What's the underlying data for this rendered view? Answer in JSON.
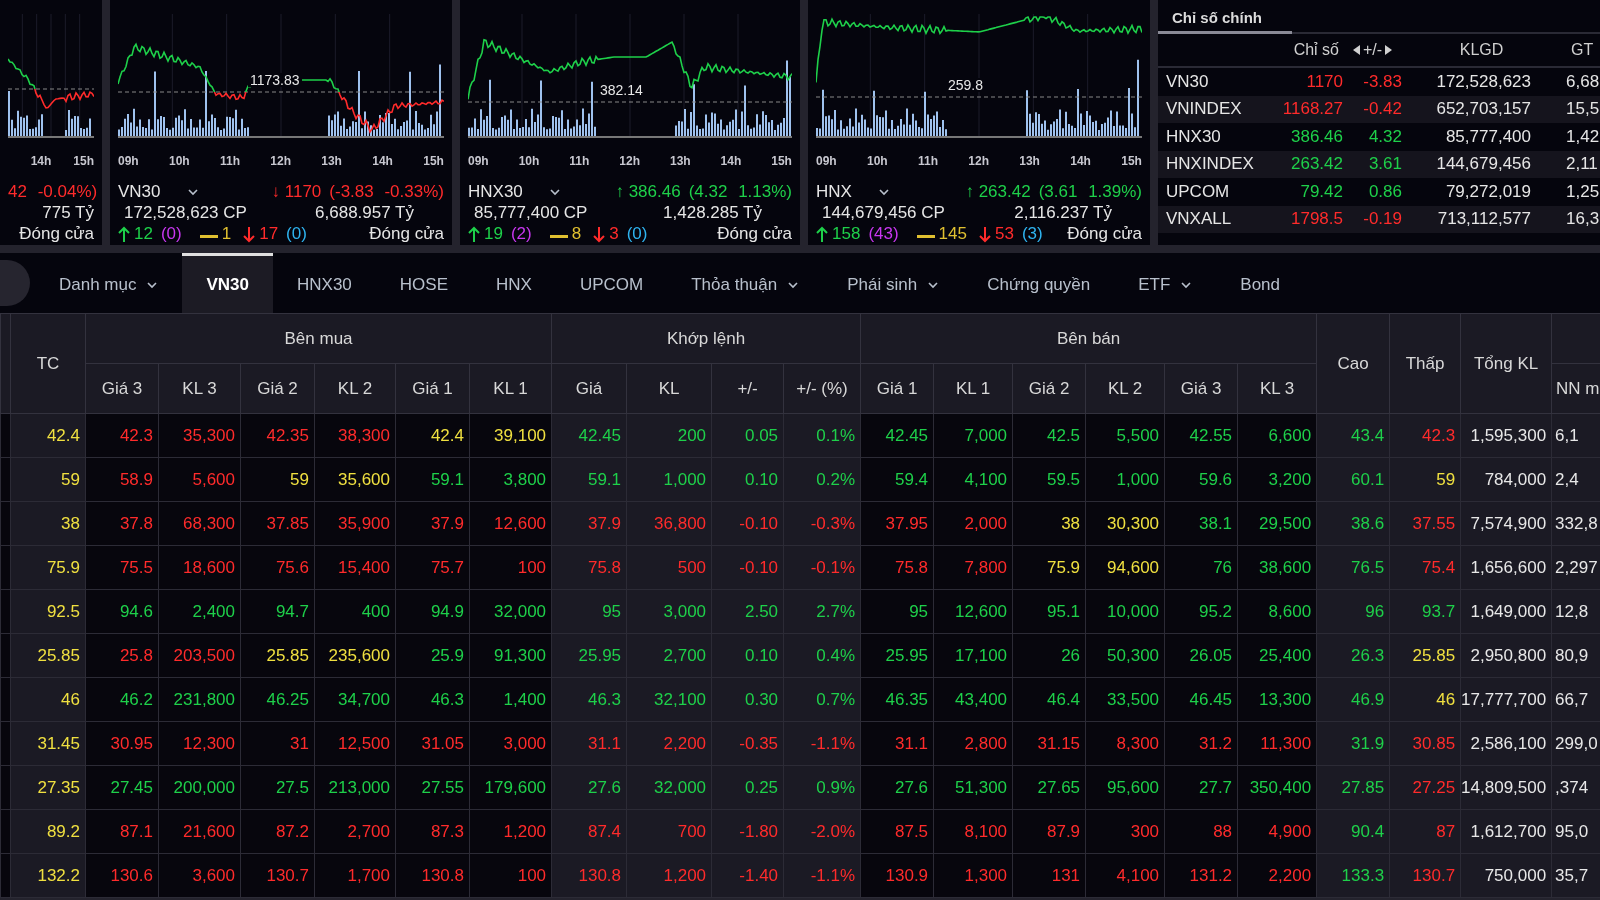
{
  "top_panels": [
    {
      "times": [
        "14h",
        "15h"
      ],
      "color": "#ff2b2b",
      "change_detail": "42 -0.04%)",
      "trade_value": "775 Tỷ",
      "status": "Đóng cửa"
    },
    {
      "name": "VN30",
      "times": [
        "09h",
        "10h",
        "11h",
        "12h",
        "13h",
        "14h",
        "15h"
      ],
      "reference_label": "1173.83",
      "arrow": "↓",
      "color": "#ff2b2b",
      "price": "1170",
      "change_detail": "(-3.83 -0.33%)",
      "volume": "172,528,623 CP",
      "trade_value": "6,688.957 Tỷ",
      "breadth": {
        "up": "12",
        "ceiling": "(0)",
        "flat": "1",
        "down": "17",
        "floor": "(0)"
      },
      "status": "Đóng cửa"
    },
    {
      "name": "HNX30",
      "times": [
        "09h",
        "10h",
        "11h",
        "12h",
        "13h",
        "14h",
        "15h"
      ],
      "reference_label": "382.14",
      "arrow": "↑",
      "color": "#1ed04a",
      "price": "386.46",
      "change_detail": "(4.32 1.13%)",
      "volume": "85,777,400 CP",
      "trade_value": "1,428.285 Tỷ",
      "breadth": {
        "up": "19",
        "ceiling": "(2)",
        "flat": "8",
        "down": "3",
        "floor": "(0)"
      },
      "status": "Đóng cửa"
    },
    {
      "name": "HNX",
      "times": [
        "09h",
        "10h",
        "11h",
        "12h",
        "13h",
        "14h",
        "15h"
      ],
      "reference_label": "259.8",
      "arrow": "↑",
      "color": "#1ed04a",
      "price": "263.42",
      "change_detail": "(3.61 1.39%)",
      "volume": "144,679,456 CP",
      "trade_value": "2,116.237 Tỷ",
      "breadth": {
        "up": "158",
        "ceiling": "(43)",
        "flat": "145",
        "down": "53",
        "floor": "(3)"
      },
      "status": "Đóng cửa"
    }
  ],
  "index_board": {
    "tab": "Chỉ số chính",
    "columns": [
      "Chỉ số",
      "+/-",
      "KLGD",
      "GT"
    ],
    "rows": [
      {
        "name": "VN30",
        "value": "1170",
        "change": "-3.83",
        "volume": "172,528,623",
        "trade_value": "6,68",
        "color": "#ff2b2b"
      },
      {
        "name": "VNINDEX",
        "value": "1168.27",
        "change": "-0.42",
        "volume": "652,703,157",
        "trade_value": "15,5",
        "color": "#ff2b2b"
      },
      {
        "name": "HNX30",
        "value": "386.46",
        "change": "4.32",
        "volume": "85,777,400",
        "trade_value": "1,42",
        "color": "#1ed04a"
      },
      {
        "name": "HNXINDEX",
        "value": "263.42",
        "change": "3.61",
        "volume": "144,679,456",
        "trade_value": "2,11",
        "color": "#1ed04a"
      },
      {
        "name": "UPCOM",
        "value": "79.42",
        "change": "0.86",
        "volume": "79,272,019",
        "trade_value": "1,25",
        "color": "#1ed04a"
      },
      {
        "name": "VNXALL",
        "value": "1798.5",
        "change": "-0.19",
        "volume": "713,112,577",
        "trade_value": "16,3",
        "color": "#ff2b2b"
      }
    ]
  },
  "tabs": [
    {
      "label": "Danh mục",
      "selected": false,
      "has_menu": true
    },
    {
      "label": "VN30",
      "selected": true,
      "has_menu": false
    },
    {
      "label": "HNX30",
      "selected": false,
      "has_menu": false
    },
    {
      "label": "HOSE",
      "selected": false,
      "has_menu": false
    },
    {
      "label": "HNX",
      "selected": false,
      "has_menu": false
    },
    {
      "label": "UPCOM",
      "selected": false,
      "has_menu": false
    },
    {
      "label": "Thỏa thuận",
      "selected": false,
      "has_menu": true
    },
    {
      "label": "Phái sinh",
      "selected": false,
      "has_menu": true
    },
    {
      "label": "Chứng quyền",
      "selected": false,
      "has_menu": false
    },
    {
      "label": "ETF",
      "selected": false,
      "has_menu": true
    },
    {
      "label": "Bond",
      "selected": false,
      "has_menu": false
    }
  ],
  "price_board": {
    "header": [
      {
        "label": "TC"
      },
      {
        "label": "Bên mua",
        "columns": [
          "Giá 3",
          "KL 3",
          "Giá 2",
          "KL 2",
          "Giá 1",
          "KL 1"
        ]
      },
      {
        "label": "Khớp lệnh",
        "columns": [
          "Giá",
          "KL",
          "+/-",
          "+/- (%)"
        ]
      },
      {
        "label": "Bên bán",
        "columns": [
          "Giá 1",
          "KL 1",
          "Giá 2",
          "KL 2",
          "Giá 3",
          "KL 3"
        ]
      },
      {
        "label": "Cao"
      },
      {
        "label": "Thấp"
      },
      {
        "label": "Tổng KL"
      },
      {
        "columns": [
          "NN m"
        ]
      }
    ],
    "rows": [
      {
        "cells": [
          {
            "text": "42.4",
            "color": "#f0e040"
          },
          {
            "text": "42.3",
            "color": "#ff2b2b"
          },
          {
            "text": "35,300",
            "color": "#ff2b2b"
          },
          {
            "text": "42.35",
            "color": "#ff2b2b"
          },
          {
            "text": "38,300",
            "color": "#ff2b2b"
          },
          {
            "text": "42.4",
            "color": "#f0e040"
          },
          {
            "text": "39,100",
            "color": "#f0e040"
          },
          {
            "text": "42.45",
            "color": "#1ed04a"
          },
          {
            "text": "200",
            "color": "#1ed04a"
          },
          {
            "text": "0.05",
            "color": "#1ed04a"
          },
          {
            "text": "0.1%",
            "color": "#1ed04a"
          },
          {
            "text": "42.45",
            "color": "#1ed04a"
          },
          {
            "text": "7,000",
            "color": "#1ed04a"
          },
          {
            "text": "42.5",
            "color": "#1ed04a"
          },
          {
            "text": "5,500",
            "color": "#1ed04a"
          },
          {
            "text": "42.55",
            "color": "#1ed04a"
          },
          {
            "text": "6,600",
            "color": "#1ed04a"
          },
          {
            "text": "43.4",
            "color": "#1ed04a"
          },
          {
            "text": "42.3",
            "color": "#ff2b2b"
          },
          {
            "text": "1,595,300",
            "color": "#e8e8e8"
          },
          {
            "text": "6,1",
            "color": "#e8e8e8"
          }
        ]
      },
      {
        "cells": [
          {
            "text": "59",
            "color": "#f0e040"
          },
          {
            "text": "58.9",
            "color": "#ff2b2b"
          },
          {
            "text": "5,600",
            "color": "#ff2b2b"
          },
          {
            "text": "59",
            "color": "#f0e040"
          },
          {
            "text": "35,600",
            "color": "#f0e040"
          },
          {
            "text": "59.1",
            "color": "#1ed04a"
          },
          {
            "text": "3,800",
            "color": "#1ed04a"
          },
          {
            "text": "59.1",
            "color": "#1ed04a"
          },
          {
            "text": "1,000",
            "color": "#1ed04a"
          },
          {
            "text": "0.10",
            "color": "#1ed04a"
          },
          {
            "text": "0.2%",
            "color": "#1ed04a"
          },
          {
            "text": "59.4",
            "color": "#1ed04a"
          },
          {
            "text": "4,100",
            "color": "#1ed04a"
          },
          {
            "text": "59.5",
            "color": "#1ed04a"
          },
          {
            "text": "1,000",
            "color": "#1ed04a"
          },
          {
            "text": "59.6",
            "color": "#1ed04a"
          },
          {
            "text": "3,200",
            "color": "#1ed04a"
          },
          {
            "text": "60.1",
            "color": "#1ed04a"
          },
          {
            "text": "59",
            "color": "#f0e040"
          },
          {
            "text": "784,000",
            "color": "#e8e8e8"
          },
          {
            "text": "2,4",
            "color": "#e8e8e8"
          }
        ]
      },
      {
        "cells": [
          {
            "text": "38",
            "color": "#f0e040"
          },
          {
            "text": "37.8",
            "color": "#ff2b2b"
          },
          {
            "text": "68,300",
            "color": "#ff2b2b"
          },
          {
            "text": "37.85",
            "color": "#ff2b2b"
          },
          {
            "text": "35,900",
            "color": "#ff2b2b"
          },
          {
            "text": "37.9",
            "color": "#ff2b2b"
          },
          {
            "text": "12,600",
            "color": "#ff2b2b"
          },
          {
            "text": "37.9",
            "color": "#ff2b2b"
          },
          {
            "text": "36,800",
            "color": "#ff2b2b"
          },
          {
            "text": "-0.10",
            "color": "#ff2b2b"
          },
          {
            "text": "-0.3%",
            "color": "#ff2b2b"
          },
          {
            "text": "37.95",
            "color": "#ff2b2b"
          },
          {
            "text": "2,000",
            "color": "#ff2b2b"
          },
          {
            "text": "38",
            "color": "#f0e040"
          },
          {
            "text": "30,300",
            "color": "#f0e040"
          },
          {
            "text": "38.1",
            "color": "#1ed04a"
          },
          {
            "text": "29,500",
            "color": "#1ed04a"
          },
          {
            "text": "38.6",
            "color": "#1ed04a"
          },
          {
            "text": "37.55",
            "color": "#ff2b2b"
          },
          {
            "text": "7,574,900",
            "color": "#e8e8e8"
          },
          {
            "text": "332,8",
            "color": "#e8e8e8"
          }
        ]
      },
      {
        "cells": [
          {
            "text": "75.9",
            "color": "#f0e040"
          },
          {
            "text": "75.5",
            "color": "#ff2b2b"
          },
          {
            "text": "18,600",
            "color": "#ff2b2b"
          },
          {
            "text": "75.6",
            "color": "#ff2b2b"
          },
          {
            "text": "15,400",
            "color": "#ff2b2b"
          },
          {
            "text": "75.7",
            "color": "#ff2b2b"
          },
          {
            "text": "100",
            "color": "#ff2b2b"
          },
          {
            "text": "75.8",
            "color": "#ff2b2b"
          },
          {
            "text": "500",
            "color": "#ff2b2b"
          },
          {
            "text": "-0.10",
            "color": "#ff2b2b"
          },
          {
            "text": "-0.1%",
            "color": "#ff2b2b"
          },
          {
            "text": "75.8",
            "color": "#ff2b2b"
          },
          {
            "text": "7,800",
            "color": "#ff2b2b"
          },
          {
            "text": "75.9",
            "color": "#f0e040"
          },
          {
            "text": "94,600",
            "color": "#f0e040"
          },
          {
            "text": "76",
            "color": "#1ed04a"
          },
          {
            "text": "38,600",
            "color": "#1ed04a"
          },
          {
            "text": "76.5",
            "color": "#1ed04a"
          },
          {
            "text": "75.4",
            "color": "#ff2b2b"
          },
          {
            "text": "1,656,600",
            "color": "#e8e8e8"
          },
          {
            "text": "2,297",
            "color": "#e8e8e8"
          }
        ]
      },
      {
        "cells": [
          {
            "text": "92.5",
            "color": "#f0e040"
          },
          {
            "text": "94.6",
            "color": "#1ed04a"
          },
          {
            "text": "2,400",
            "color": "#1ed04a"
          },
          {
            "text": "94.7",
            "color": "#1ed04a"
          },
          {
            "text": "400",
            "color": "#1ed04a"
          },
          {
            "text": "94.9",
            "color": "#1ed04a"
          },
          {
            "text": "32,000",
            "color": "#1ed04a"
          },
          {
            "text": "95",
            "color": "#1ed04a"
          },
          {
            "text": "3,000",
            "color": "#1ed04a"
          },
          {
            "text": "2.50",
            "color": "#1ed04a"
          },
          {
            "text": "2.7%",
            "color": "#1ed04a"
          },
          {
            "text": "95",
            "color": "#1ed04a"
          },
          {
            "text": "12,600",
            "color": "#1ed04a"
          },
          {
            "text": "95.1",
            "color": "#1ed04a"
          },
          {
            "text": "10,000",
            "color": "#1ed04a"
          },
          {
            "text": "95.2",
            "color": "#1ed04a"
          },
          {
            "text": "8,600",
            "color": "#1ed04a"
          },
          {
            "text": "96",
            "color": "#1ed04a"
          },
          {
            "text": "93.7",
            "color": "#1ed04a"
          },
          {
            "text": "1,649,000",
            "color": "#e8e8e8"
          },
          {
            "text": "12,8",
            "color": "#e8e8e8"
          }
        ]
      },
      {
        "cells": [
          {
            "text": "25.85",
            "color": "#f0e040"
          },
          {
            "text": "25.8",
            "color": "#ff2b2b"
          },
          {
            "text": "203,500",
            "color": "#ff2b2b"
          },
          {
            "text": "25.85",
            "color": "#f0e040"
          },
          {
            "text": "235,600",
            "color": "#f0e040"
          },
          {
            "text": "25.9",
            "color": "#1ed04a"
          },
          {
            "text": "91,300",
            "color": "#1ed04a"
          },
          {
            "text": "25.95",
            "color": "#1ed04a"
          },
          {
            "text": "2,700",
            "color": "#1ed04a"
          },
          {
            "text": "0.10",
            "color": "#1ed04a"
          },
          {
            "text": "0.4%",
            "color": "#1ed04a"
          },
          {
            "text": "25.95",
            "color": "#1ed04a"
          },
          {
            "text": "17,100",
            "color": "#1ed04a"
          },
          {
            "text": "26",
            "color": "#1ed04a"
          },
          {
            "text": "50,300",
            "color": "#1ed04a"
          },
          {
            "text": "26.05",
            "color": "#1ed04a"
          },
          {
            "text": "25,400",
            "color": "#1ed04a"
          },
          {
            "text": "26.3",
            "color": "#1ed04a"
          },
          {
            "text": "25.85",
            "color": "#f0e040"
          },
          {
            "text": "2,950,800",
            "color": "#e8e8e8"
          },
          {
            "text": "80,9",
            "color": "#e8e8e8"
          }
        ]
      },
      {
        "cells": [
          {
            "text": "46",
            "color": "#f0e040"
          },
          {
            "text": "46.2",
            "color": "#1ed04a"
          },
          {
            "text": "231,800",
            "color": "#1ed04a"
          },
          {
            "text": "46.25",
            "color": "#1ed04a"
          },
          {
            "text": "34,700",
            "color": "#1ed04a"
          },
          {
            "text": "46.3",
            "color": "#1ed04a"
          },
          {
            "text": "1,400",
            "color": "#1ed04a"
          },
          {
            "text": "46.3",
            "color": "#1ed04a"
          },
          {
            "text": "32,100",
            "color": "#1ed04a"
          },
          {
            "text": "0.30",
            "color": "#1ed04a"
          },
          {
            "text": "0.7%",
            "color": "#1ed04a"
          },
          {
            "text": "46.35",
            "color": "#1ed04a"
          },
          {
            "text": "43,400",
            "color": "#1ed04a"
          },
          {
            "text": "46.4",
            "color": "#1ed04a"
          },
          {
            "text": "33,500",
            "color": "#1ed04a"
          },
          {
            "text": "46.45",
            "color": "#1ed04a"
          },
          {
            "text": "13,300",
            "color": "#1ed04a"
          },
          {
            "text": "46.9",
            "color": "#1ed04a"
          },
          {
            "text": "46",
            "color": "#f0e040"
          },
          {
            "text": "17,777,700",
            "color": "#e8e8e8"
          },
          {
            "text": "66,7",
            "color": "#e8e8e8"
          }
        ]
      },
      {
        "cells": [
          {
            "text": "31.45",
            "color": "#f0e040"
          },
          {
            "text": "30.95",
            "color": "#ff2b2b"
          },
          {
            "text": "12,300",
            "color": "#ff2b2b"
          },
          {
            "text": "31",
            "color": "#ff2b2b"
          },
          {
            "text": "12,500",
            "color": "#ff2b2b"
          },
          {
            "text": "31.05",
            "color": "#ff2b2b"
          },
          {
            "text": "3,000",
            "color": "#ff2b2b"
          },
          {
            "text": "31.1",
            "color": "#ff2b2b"
          },
          {
            "text": "2,200",
            "color": "#ff2b2b"
          },
          {
            "text": "-0.35",
            "color": "#ff2b2b"
          },
          {
            "text": "-1.1%",
            "color": "#ff2b2b"
          },
          {
            "text": "31.1",
            "color": "#ff2b2b"
          },
          {
            "text": "2,800",
            "color": "#ff2b2b"
          },
          {
            "text": "31.15",
            "color": "#ff2b2b"
          },
          {
            "text": "8,300",
            "color": "#ff2b2b"
          },
          {
            "text": "31.2",
            "color": "#ff2b2b"
          },
          {
            "text": "11,300",
            "color": "#ff2b2b"
          },
          {
            "text": "31.9",
            "color": "#1ed04a"
          },
          {
            "text": "30.85",
            "color": "#ff2b2b"
          },
          {
            "text": "2,586,100",
            "color": "#e8e8e8"
          },
          {
            "text": "299,0",
            "color": "#e8e8e8"
          }
        ]
      },
      {
        "cells": [
          {
            "text": "27.35",
            "color": "#f0e040"
          },
          {
            "text": "27.45",
            "color": "#1ed04a"
          },
          {
            "text": "200,000",
            "color": "#1ed04a"
          },
          {
            "text": "27.5",
            "color": "#1ed04a"
          },
          {
            "text": "213,000",
            "color": "#1ed04a"
          },
          {
            "text": "27.55",
            "color": "#1ed04a"
          },
          {
            "text": "179,600",
            "color": "#1ed04a"
          },
          {
            "text": "27.6",
            "color": "#1ed04a"
          },
          {
            "text": "32,000",
            "color": "#1ed04a"
          },
          {
            "text": "0.25",
            "color": "#1ed04a"
          },
          {
            "text": "0.9%",
            "color": "#1ed04a"
          },
          {
            "text": "27.6",
            "color": "#1ed04a"
          },
          {
            "text": "51,300",
            "color": "#1ed04a"
          },
          {
            "text": "27.65",
            "color": "#1ed04a"
          },
          {
            "text": "95,600",
            "color": "#1ed04a"
          },
          {
            "text": "27.7",
            "color": "#1ed04a"
          },
          {
            "text": "350,400",
            "color": "#1ed04a"
          },
          {
            "text": "27.85",
            "color": "#1ed04a"
          },
          {
            "text": "27.25",
            "color": "#ff2b2b"
          },
          {
            "text": "14,809,500",
            "color": "#e8e8e8"
          },
          {
            "text": ",374",
            "color": "#e8e8e8"
          }
        ]
      },
      {
        "cells": [
          {
            "text": "89.2",
            "color": "#f0e040"
          },
          {
            "text": "87.1",
            "color": "#ff2b2b"
          },
          {
            "text": "21,600",
            "color": "#ff2b2b"
          },
          {
            "text": "87.2",
            "color": "#ff2b2b"
          },
          {
            "text": "2,700",
            "color": "#ff2b2b"
          },
          {
            "text": "87.3",
            "color": "#ff2b2b"
          },
          {
            "text": "1,200",
            "color": "#ff2b2b"
          },
          {
            "text": "87.4",
            "color": "#ff2b2b"
          },
          {
            "text": "700",
            "color": "#ff2b2b"
          },
          {
            "text": "-1.80",
            "color": "#ff2b2b"
          },
          {
            "text": "-2.0%",
            "color": "#ff2b2b"
          },
          {
            "text": "87.5",
            "color": "#ff2b2b"
          },
          {
            "text": "8,100",
            "color": "#ff2b2b"
          },
          {
            "text": "87.9",
            "color": "#ff2b2b"
          },
          {
            "text": "300",
            "color": "#ff2b2b"
          },
          {
            "text": "88",
            "color": "#ff2b2b"
          },
          {
            "text": "4,900",
            "color": "#ff2b2b"
          },
          {
            "text": "90.4",
            "color": "#1ed04a"
          },
          {
            "text": "87",
            "color": "#ff2b2b"
          },
          {
            "text": "1,612,700",
            "color": "#e8e8e8"
          },
          {
            "text": "95,0",
            "color": "#e8e8e8"
          }
        ]
      },
      {
        "cells": [
          {
            "text": "132.2",
            "color": "#f0e040"
          },
          {
            "text": "130.6",
            "color": "#ff2b2b"
          },
          {
            "text": "3,600",
            "color": "#ff2b2b"
          },
          {
            "text": "130.7",
            "color": "#ff2b2b"
          },
          {
            "text": "1,700",
            "color": "#ff2b2b"
          },
          {
            "text": "130.8",
            "color": "#ff2b2b"
          },
          {
            "text": "100",
            "color": "#ff2b2b"
          },
          {
            "text": "130.8",
            "color": "#ff2b2b"
          },
          {
            "text": "1,200",
            "color": "#ff2b2b"
          },
          {
            "text": "-1.40",
            "color": "#ff2b2b"
          },
          {
            "text": "-1.1%",
            "color": "#ff2b2b"
          },
          {
            "text": "130.9",
            "color": "#ff2b2b"
          },
          {
            "text": "1,300",
            "color": "#ff2b2b"
          },
          {
            "text": "131",
            "color": "#ff2b2b"
          },
          {
            "text": "4,100",
            "color": "#ff2b2b"
          },
          {
            "text": "131.2",
            "color": "#ff2b2b"
          },
          {
            "text": "2,200",
            "color": "#ff2b2b"
          },
          {
            "text": "133.3",
            "color": "#1ed04a"
          },
          {
            "text": "130.7",
            "color": "#ff2b2b"
          },
          {
            "text": "750,000",
            "color": "#e8e8e8"
          },
          {
            "text": "35,7",
            "color": "#e8e8e8"
          }
        ]
      }
    ]
  }
}
